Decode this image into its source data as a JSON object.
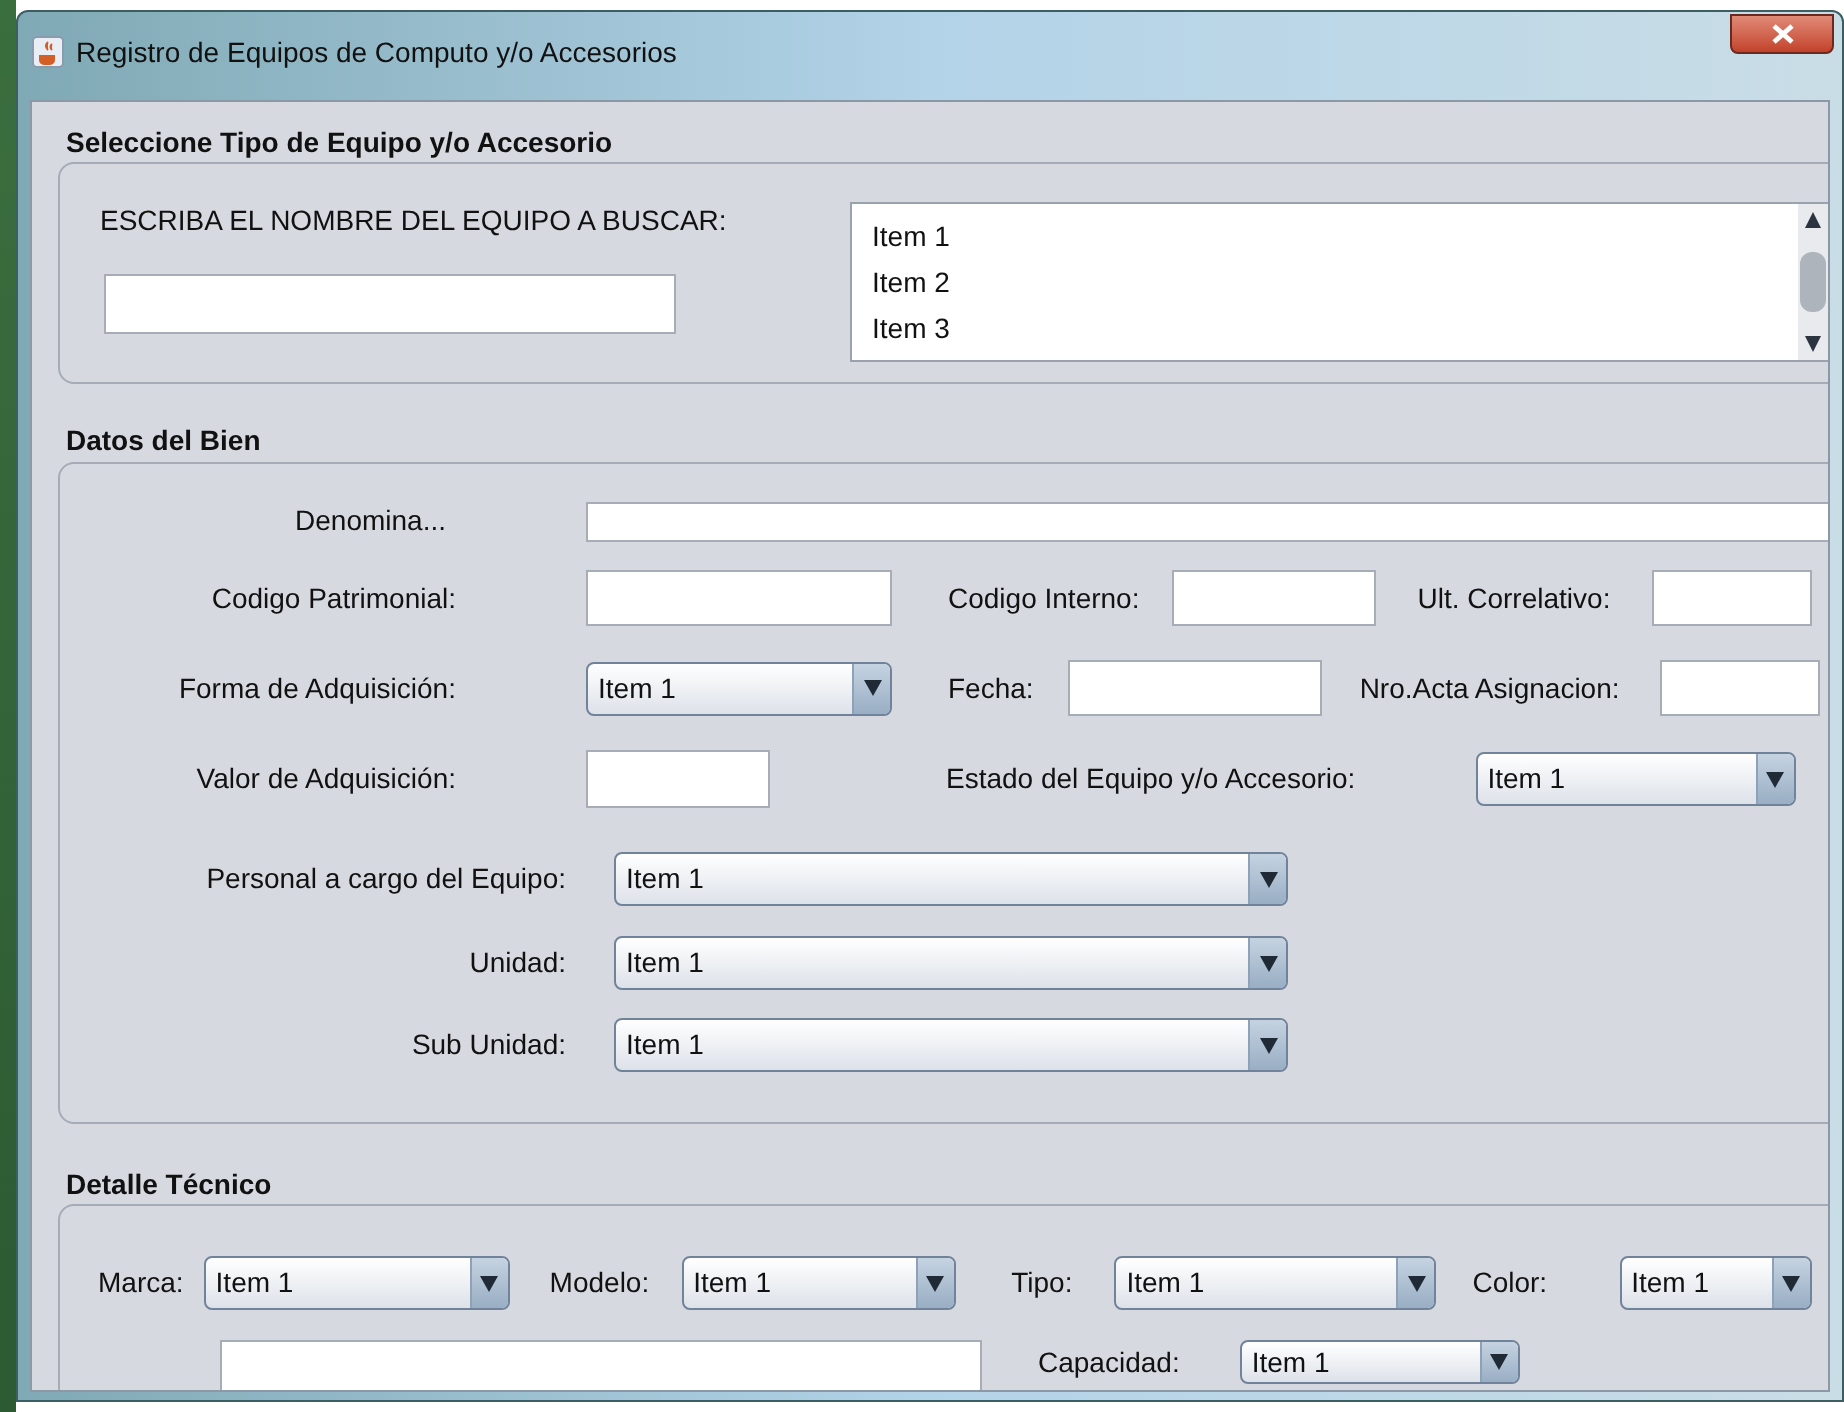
{
  "window": {
    "title": "Registro de Equipos de Computo y/o Accesorios"
  },
  "seleccion": {
    "title": "Seleccione Tipo de Equipo y/o Accesorio",
    "search_label": "ESCRIBA EL NOMBRE DEL EQUIPO A BUSCAR:",
    "list": [
      "Item 1",
      "Item 2",
      "Item 3"
    ]
  },
  "datos": {
    "title": "Datos del Bien",
    "denominacion": {
      "label": "Denomina..."
    },
    "codigo_patrimonial": {
      "label": "Codigo Patrimonial:"
    },
    "codigo_interno": {
      "label": "Codigo Interno:"
    },
    "ult_correlativo": {
      "label": "Ult. Correlativo:"
    },
    "forma_adquisicion": {
      "label": "Forma de Adquisición:",
      "value": "Item 1"
    },
    "fecha": {
      "label": "Fecha:"
    },
    "nro_acta": {
      "label": "Nro.Acta Asignacion:"
    },
    "valor_adquisicion": {
      "label": "Valor de Adquisición:"
    },
    "estado": {
      "label": "Estado del Equipo y/o Accesorio:",
      "value": "Item 1"
    },
    "personal": {
      "label": "Personal a cargo del Equipo:",
      "value": "Item 1"
    },
    "unidad": {
      "label": "Unidad:",
      "value": "Item 1"
    },
    "sub_unidad": {
      "label": "Sub Unidad:",
      "value": "Item 1"
    }
  },
  "detalle": {
    "title": "Detalle Técnico",
    "marca": {
      "label": "Marca:",
      "value": "Item 1"
    },
    "modelo": {
      "label": "Modelo:",
      "value": "Item 1"
    },
    "tipo": {
      "label": "Tipo:",
      "value": "Item 1"
    },
    "color": {
      "label": "Color:",
      "value": "Item 1"
    },
    "capacidad": {
      "label": "Capacidad:",
      "value": "Item 1"
    }
  }
}
